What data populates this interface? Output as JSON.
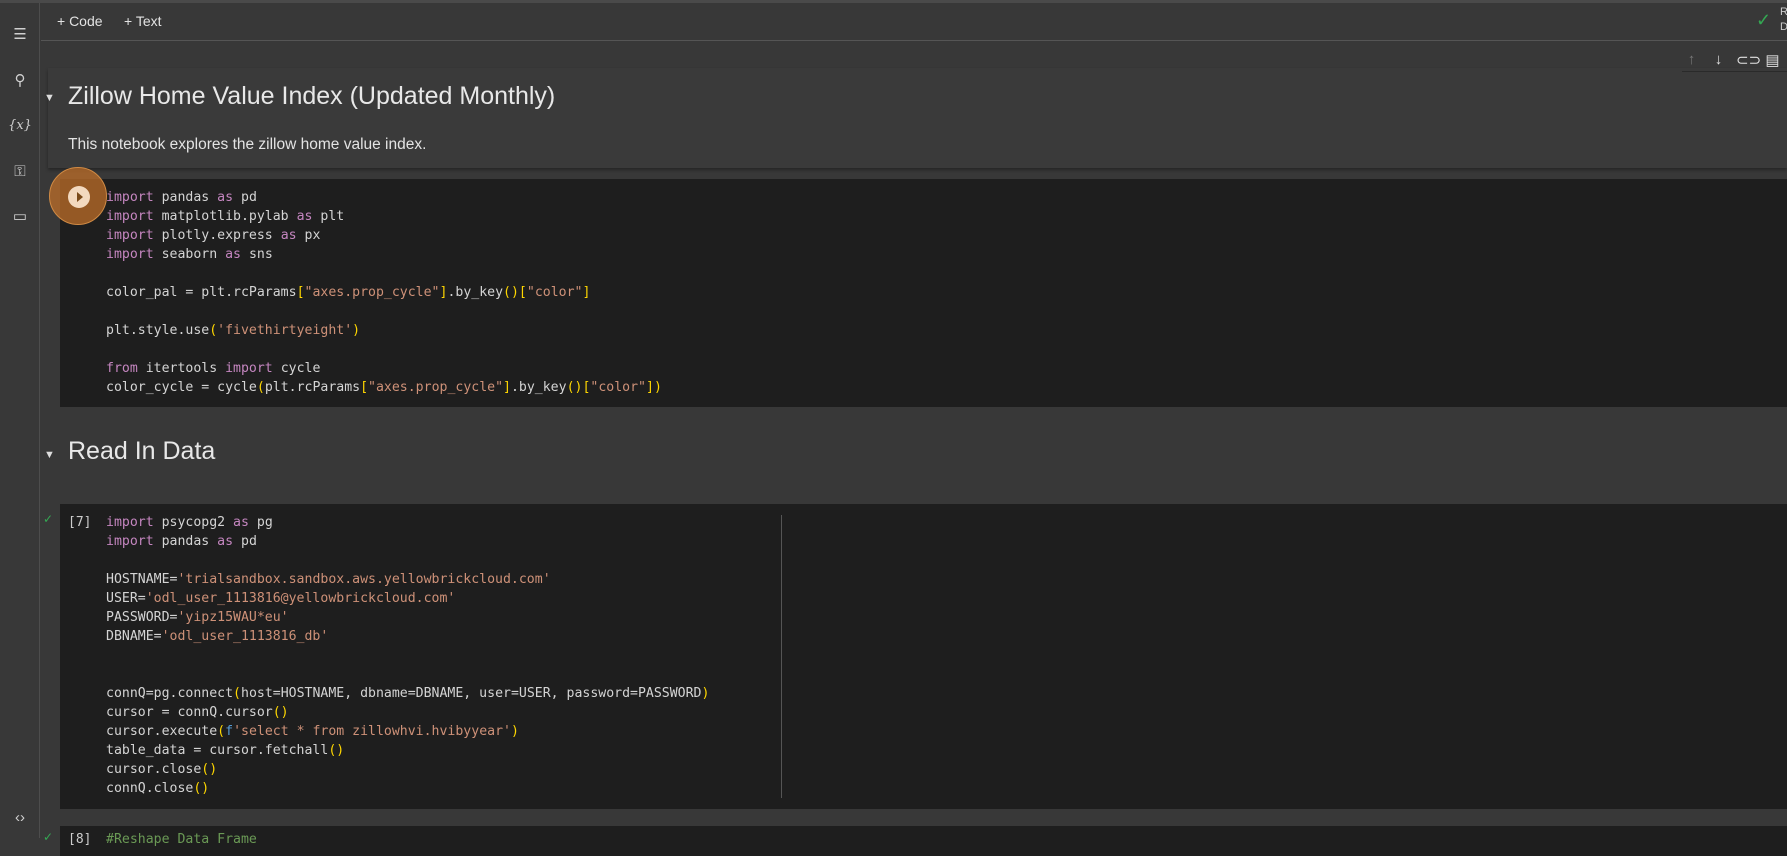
{
  "toolbar": {
    "add_code": "+ Code",
    "add_text": "+ Text",
    "status_line1": "R",
    "status_line2": "D"
  },
  "sidebar": {
    "icons": [
      "table-of-contents-icon",
      "search-icon",
      "variables-icon",
      "secrets-key-icon",
      "files-folder-icon",
      "code-snippets-icon"
    ]
  },
  "cell_toolbar": {
    "icons": [
      "move-up-icon",
      "move-down-icon",
      "link-icon",
      "comment-icon"
    ]
  },
  "heading1": "Zillow Home Value Index (Updated Monthly)",
  "intro": "This notebook explores the zillow home value index.",
  "heading2": "Read In Data",
  "cells": [
    {
      "exec": "",
      "lines": [
        [
          [
            "import",
            "kw"
          ],
          [
            " pandas ",
            "tx"
          ],
          [
            "as",
            "kw"
          ],
          [
            " pd",
            "tx"
          ]
        ],
        [
          [
            "import",
            "kw"
          ],
          [
            " matplotlib.pylab ",
            "tx"
          ],
          [
            "as",
            "kw"
          ],
          [
            " plt",
            "tx"
          ]
        ],
        [
          [
            "import",
            "kw"
          ],
          [
            " plotly.express ",
            "tx"
          ],
          [
            "as",
            "kw"
          ],
          [
            " px",
            "tx"
          ]
        ],
        [
          [
            "import",
            "kw"
          ],
          [
            " seaborn ",
            "tx"
          ],
          [
            "as",
            "kw"
          ],
          [
            " sns",
            "tx"
          ]
        ],
        [],
        [
          [
            "color_pal = plt.rcParams",
            "tx"
          ],
          [
            "[",
            "par"
          ],
          [
            "\"axes.prop_cycle\"",
            "str"
          ],
          [
            "]",
            "par"
          ],
          [
            ".by_key",
            "tx"
          ],
          [
            "()",
            "par"
          ],
          [
            "[",
            "par"
          ],
          [
            "\"color\"",
            "str"
          ],
          [
            "]",
            "par"
          ]
        ],
        [],
        [
          [
            "plt.style.use",
            "tx"
          ],
          [
            "(",
            "par"
          ],
          [
            "'fivethirtyeight'",
            "str"
          ],
          [
            ")",
            "par"
          ]
        ],
        [],
        [
          [
            "from",
            "kw"
          ],
          [
            " itertools ",
            "tx"
          ],
          [
            "import",
            "kw"
          ],
          [
            " cycle",
            "tx"
          ]
        ],
        [
          [
            "color_cycle = cycle",
            "tx"
          ],
          [
            "(",
            "par"
          ],
          [
            "plt.rcParams",
            "tx"
          ],
          [
            "[",
            "par"
          ],
          [
            "\"axes.prop_cycle\"",
            "str"
          ],
          [
            "]",
            "par"
          ],
          [
            ".by_key",
            "tx"
          ],
          [
            "()",
            "par"
          ],
          [
            "[",
            "par"
          ],
          [
            "\"color\"",
            "str"
          ],
          [
            "]",
            "par"
          ],
          [
            ")",
            "par"
          ]
        ]
      ]
    },
    {
      "exec": "[7]",
      "lines": [
        [
          [
            "import",
            "kw"
          ],
          [
            " psycopg2 ",
            "tx"
          ],
          [
            "as",
            "kw"
          ],
          [
            " pg",
            "tx"
          ]
        ],
        [
          [
            "import",
            "kw"
          ],
          [
            " pandas ",
            "tx"
          ],
          [
            "as",
            "kw"
          ],
          [
            " pd",
            "tx"
          ]
        ],
        [],
        [
          [
            "HOSTNAME=",
            "tx"
          ],
          [
            "'trialsandbox.sandbox.aws.yellowbrickcloud.com'",
            "str"
          ]
        ],
        [
          [
            "USER=",
            "tx"
          ],
          [
            "'odl_user_1113816@yellowbrickcloud.com'",
            "str"
          ]
        ],
        [
          [
            "PASSWORD=",
            "tx"
          ],
          [
            "'yipz15WAU*eu'",
            "str"
          ]
        ],
        [
          [
            "DBNAME=",
            "tx"
          ],
          [
            "'odl_user_1113816_db'",
            "str"
          ]
        ],
        [],
        [],
        [
          [
            "connQ=pg.connect",
            "tx"
          ],
          [
            "(",
            "par"
          ],
          [
            "host=HOSTNAME, dbname=DBNAME, user=USER, password=PASSWORD",
            "tx"
          ],
          [
            ")",
            "par"
          ]
        ],
        [
          [
            "cursor = connQ.cursor",
            "tx"
          ],
          [
            "()",
            "par"
          ]
        ],
        [
          [
            "cursor.execute",
            "tx"
          ],
          [
            "(",
            "par"
          ],
          [
            "f",
            "fpre"
          ],
          [
            "'select * from zillowhvi.hvibyyear'",
            "str"
          ],
          [
            ")",
            "par"
          ]
        ],
        [
          [
            "table_data = cursor.fetchall",
            "tx"
          ],
          [
            "()",
            "par"
          ]
        ],
        [
          [
            "cursor.close",
            "tx"
          ],
          [
            "()",
            "par"
          ]
        ],
        [
          [
            "connQ.close",
            "tx"
          ],
          [
            "()",
            "par"
          ]
        ]
      ]
    },
    {
      "exec": "[8]",
      "lines": [
        [
          [
            "#Reshape Data Frame",
            "cm"
          ]
        ]
      ]
    }
  ]
}
